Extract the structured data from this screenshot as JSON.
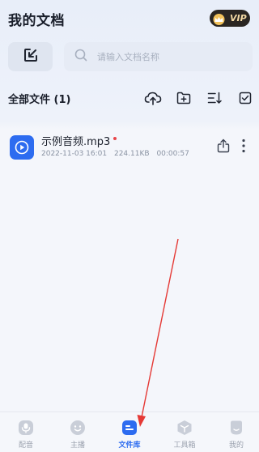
{
  "header": {
    "title": "我的文档",
    "vip_label": "VIP"
  },
  "search": {
    "placeholder": "请输入文档名称"
  },
  "file_section": {
    "title": "全部文件 (1)"
  },
  "files": [
    {
      "name": "示例音频.mp3",
      "date": "2022-11-03 16:01",
      "size": "224.11KB",
      "duration": "00:00:57"
    }
  ],
  "nav": {
    "items": [
      {
        "label": "配音",
        "icon": "dubbing-icon"
      },
      {
        "label": "主播",
        "icon": "anchor-icon"
      },
      {
        "label": "文件库",
        "icon": "file-library-icon"
      },
      {
        "label": "工具箱",
        "icon": "toolbox-icon"
      },
      {
        "label": "我的",
        "icon": "profile-icon"
      }
    ],
    "active_index": 2
  },
  "colors": {
    "accent": "#2d6cf0",
    "annotation_arrow": "#e53935",
    "vip_bg": "#2a2622",
    "vip_text": "#f3d9a4",
    "new_dot": "#e8464a"
  }
}
